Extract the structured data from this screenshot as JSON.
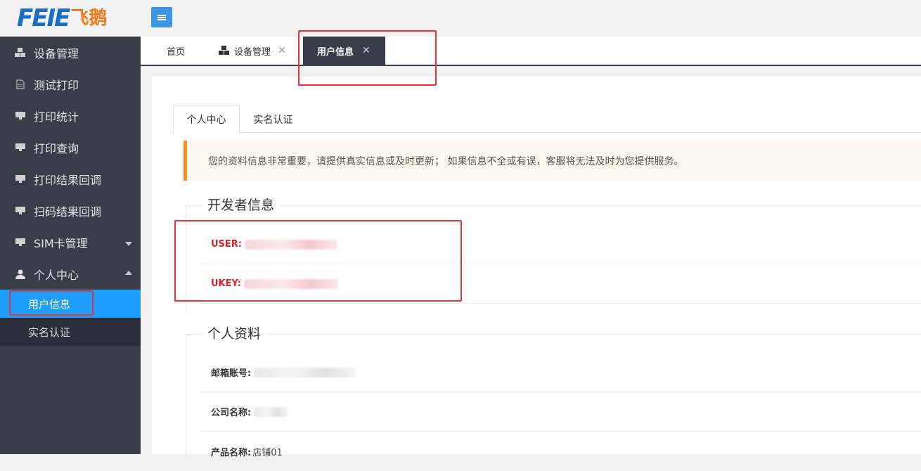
{
  "logo": {
    "en": "FEIE",
    "cn": "飞鹅"
  },
  "sidebar": {
    "items": [
      {
        "label": "设备管理",
        "icon": "cubes-icon"
      },
      {
        "label": "测试打印",
        "icon": "document-icon"
      },
      {
        "label": "打印统计",
        "icon": "monitor-icon"
      },
      {
        "label": "打印查询",
        "icon": "monitor-icon"
      },
      {
        "label": "打印结果回调",
        "icon": "monitor-icon"
      },
      {
        "label": "扫码结果回调",
        "icon": "monitor-icon"
      },
      {
        "label": "SIM卡管理",
        "icon": "monitor-icon"
      },
      {
        "label": "个人中心",
        "icon": "user-icon"
      }
    ],
    "sub_items": [
      {
        "label": "用户信息",
        "active": true
      },
      {
        "label": "实名认证",
        "active": false
      }
    ]
  },
  "tabs": [
    {
      "label": "首页"
    },
    {
      "label": "设备管理"
    },
    {
      "label": "用户信息",
      "active": true
    }
  ],
  "content": {
    "tabs": [
      {
        "label": "个人中心",
        "active": true
      },
      {
        "label": "实名认证"
      }
    ],
    "notice": "您的资料信息非常重要，请提供真实信息或及时更新；  如果信息不全或有误，客服将无法及时为您提供服务。",
    "developer": {
      "title": "开发者信息",
      "user_label": "USER:",
      "ukey_label": "UKEY:"
    },
    "profile": {
      "title": "个人资料",
      "email_label": "邮箱账号:",
      "company_label": "公司名称:",
      "product_label": "产品名称:",
      "product_value": "店铺01"
    }
  },
  "colors": {
    "sidebar_bg": "#393d49",
    "active_blue": "#1e9fff",
    "notice_accent": "#ff8b25",
    "highlight_red": "#e53333"
  }
}
